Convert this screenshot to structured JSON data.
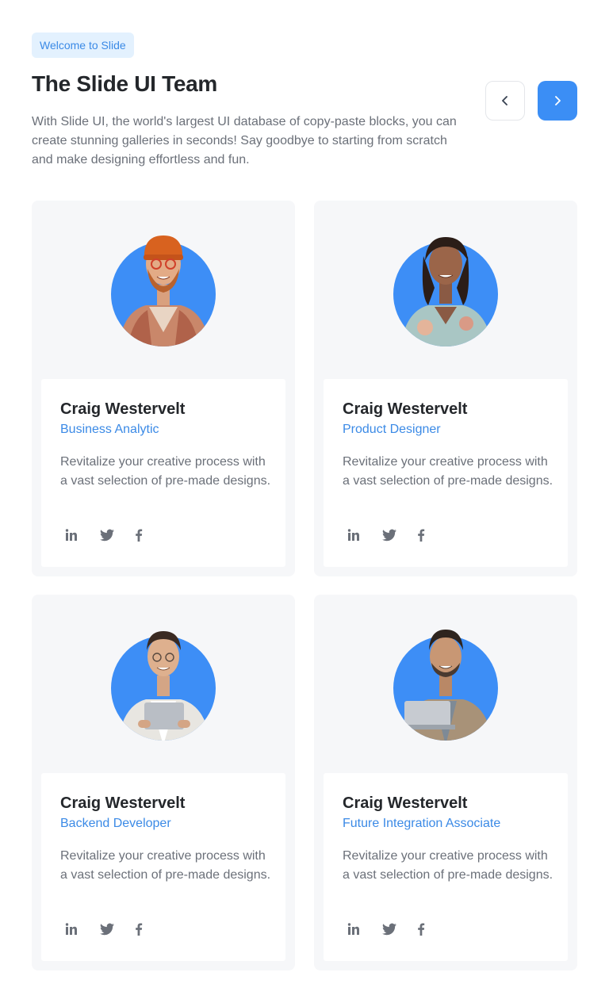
{
  "header": {
    "badge": "Welcome to Slide",
    "title": "The Slide UI Team",
    "description": "With Slide UI, the world's largest UI database of copy-paste blocks, you can create stunning galleries in seconds! Say goodbye to starting from scratch and make designing effortless and fun."
  },
  "nav": {
    "prev_icon": "chevron-left-icon",
    "next_icon": "chevron-right-icon"
  },
  "colors": {
    "accent": "#3b8ef5",
    "badge_bg": "#e3f1fe",
    "card_bg": "#f6f7f9"
  },
  "team": [
    {
      "name": "Craig Westervelt",
      "role": "Business Analytic",
      "bio": "Revitalize your creative process with a vast selection of pre-made designs."
    },
    {
      "name": "Craig Westervelt",
      "role": "Product Designer",
      "bio": "Revitalize your creative process with a vast selection of pre-made designs."
    },
    {
      "name": "Craig Westervelt",
      "role": "Backend Developer",
      "bio": "Revitalize your creative process with a vast selection of pre-made designs."
    },
    {
      "name": "Craig Westervelt",
      "role": "Future Integration Associate",
      "bio": "Revitalize your creative process with a vast selection of pre-made designs."
    }
  ],
  "social_icons": [
    "linkedin-icon",
    "twitter-icon",
    "facebook-icon"
  ]
}
